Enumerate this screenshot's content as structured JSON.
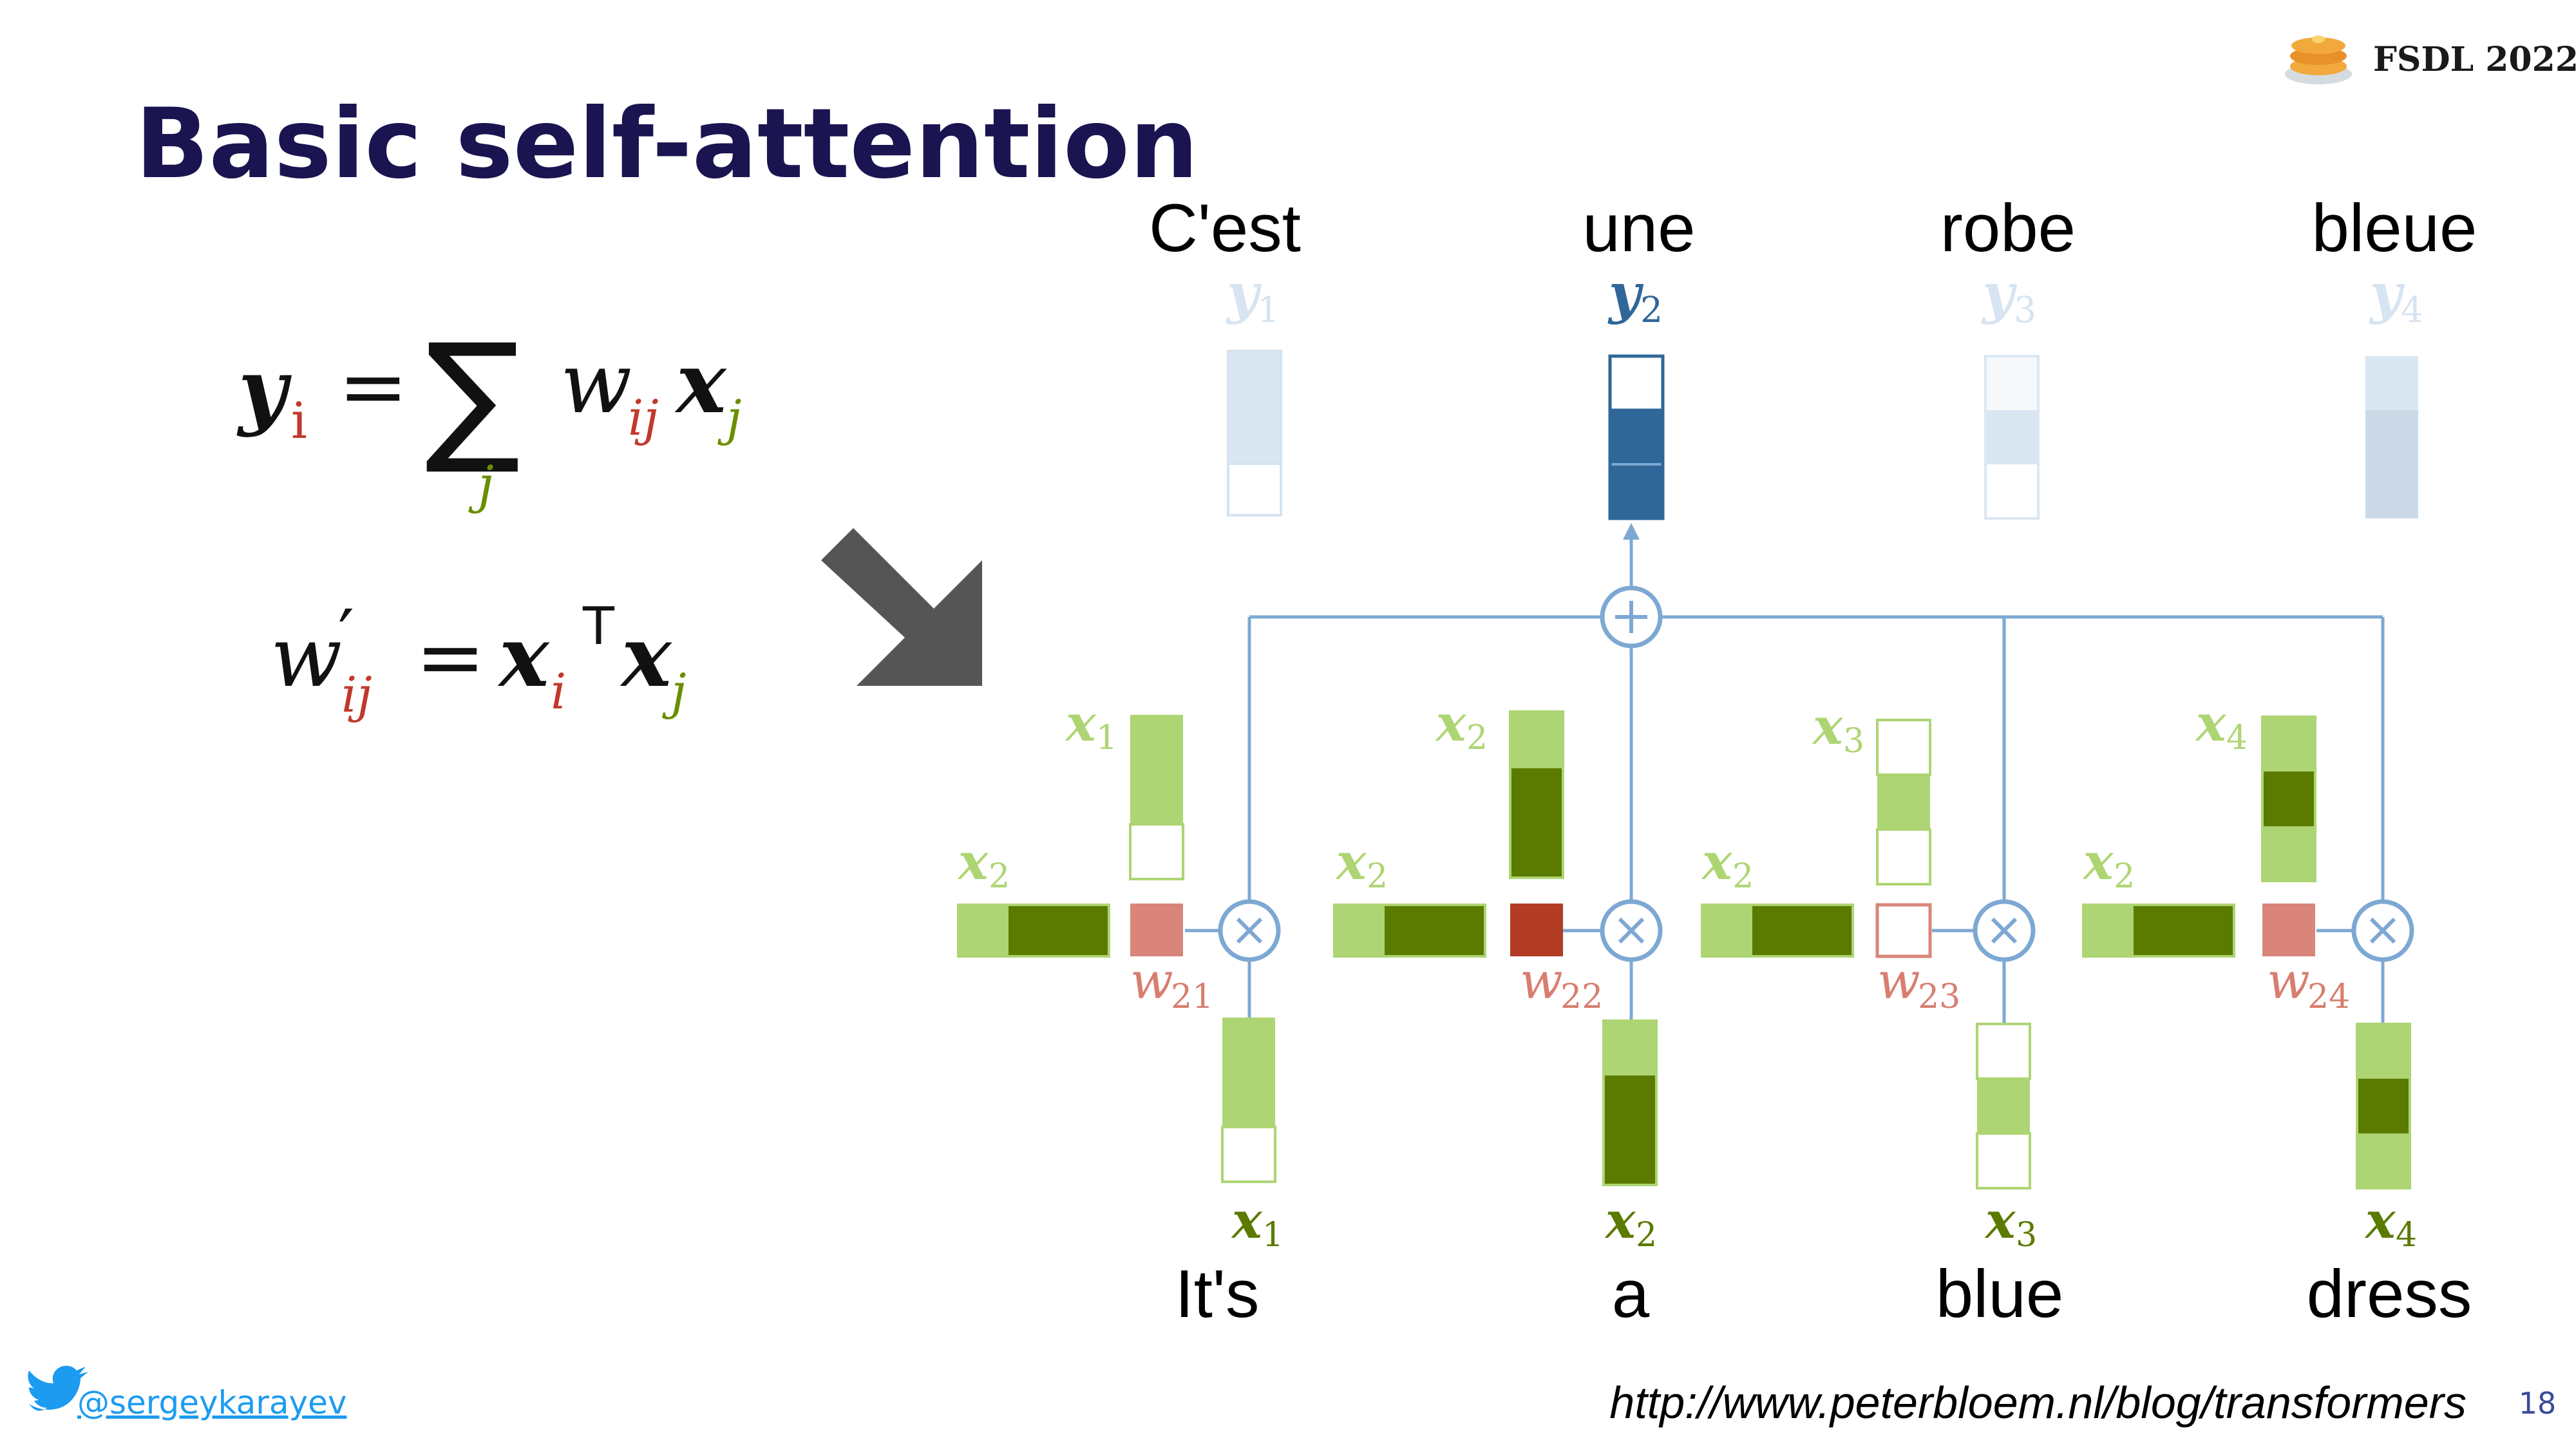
{
  "title": "Basic self-attention",
  "brand": {
    "label": "FSDL 2022",
    "logo_icon": "pancake-stack-icon"
  },
  "formula1": {
    "lhs": "y",
    "lhs_sub": "i",
    "equals": "=",
    "sum": "∑",
    "sum_index": "j",
    "w": "w",
    "w_sub": "ij",
    "x": "x",
    "x_sub": "j"
  },
  "formula2": {
    "w": "w",
    "prime": "′",
    "w_sub": "ij",
    "equals": "=",
    "xi": "x",
    "xi_sub": "i",
    "transpose": "T",
    "xj": "x",
    "xj_sub": "j"
  },
  "arrow_icon": "down-right-arrow-icon",
  "output_words": [
    "C'est",
    "une",
    "robe",
    "bleue"
  ],
  "input_words": [
    "It's",
    "a",
    "blue",
    "dress"
  ],
  "y_labels": [
    {
      "base": "y",
      "sub": "1"
    },
    {
      "base": "y",
      "sub": "2"
    },
    {
      "base": "y",
      "sub": "3"
    },
    {
      "base": "y",
      "sub": "4"
    }
  ],
  "x_labels": [
    {
      "base": "x",
      "sub": "1"
    },
    {
      "base": "x",
      "sub": "2"
    },
    {
      "base": "x",
      "sub": "3"
    },
    {
      "base": "x",
      "sub": "4"
    }
  ],
  "query_labels": [
    {
      "base": "x",
      "sub": "2"
    },
    {
      "base": "x",
      "sub": "2"
    },
    {
      "base": "x",
      "sub": "2"
    },
    {
      "base": "x",
      "sub": "2"
    }
  ],
  "weight_labels": [
    {
      "base": "w",
      "sub": "21"
    },
    {
      "base": "w",
      "sub": "22"
    },
    {
      "base": "w",
      "sub": "23"
    },
    {
      "base": "w",
      "sub": "24"
    }
  ],
  "plus_icon": "plus-circle-icon",
  "times_icon": "times-circle-icon",
  "colors": {
    "title": "#1a1550",
    "light_green": "#aed573",
    "dark_green": "#5b7a00",
    "label_green": "#8cbf4a",
    "weight_red": "#d9857a",
    "weight_dark_red": "#b23c24",
    "weight_label": "#d87e70",
    "line_blue": "#7da8d3",
    "y_dark": "#2f6798",
    "twitter": "#1d9bf0"
  },
  "footer": {
    "twitter_icon": "twitter-bird-icon",
    "handle": "@sergeykarayev",
    "url": "http://www.peterbloem.nl/blog/transformers",
    "page_number": "18"
  }
}
